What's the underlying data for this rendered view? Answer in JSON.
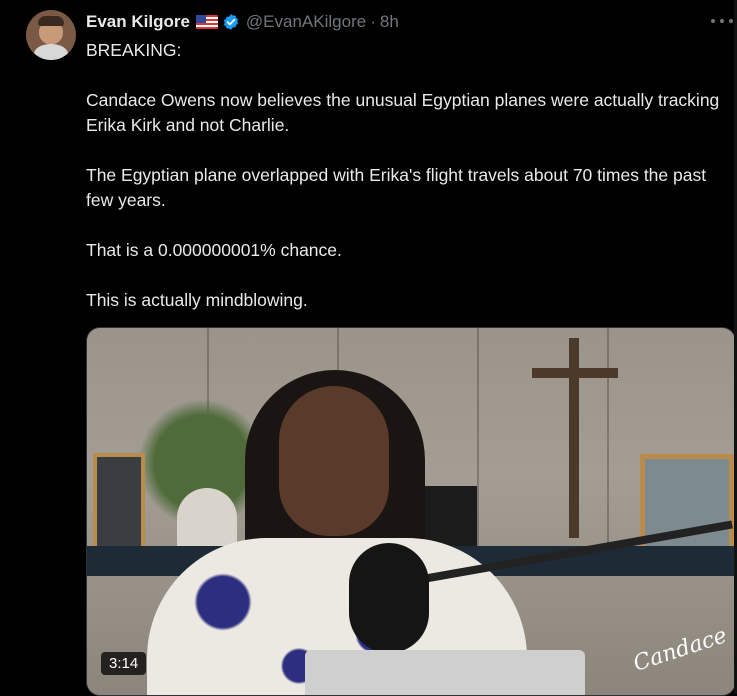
{
  "tweet": {
    "author_name": "Evan Kilgore",
    "flag_icon": "us-flag-icon",
    "verified_icon": "verified-badge-icon",
    "handle": "@EvanAKilgore",
    "separator": "·",
    "time": "8h",
    "more_icon": "more-options-icon",
    "paragraphs": [
      "BREAKING:",
      "Candace Owens now believes the unusual Egyptian planes were actually tracking Erika Kirk and not Charlie.",
      "The Egyptian plane overlapped with Erika's flight travels about 70 times the past few years.",
      "That is a 0.000000001% chance.",
      "This is actually mindblowing."
    ]
  },
  "media": {
    "duration": "3:14",
    "watermark": "Candace"
  },
  "colors": {
    "background": "#000000",
    "text": "#e7e9ea",
    "muted": "#71767b",
    "verified": "#1d9bf0"
  }
}
